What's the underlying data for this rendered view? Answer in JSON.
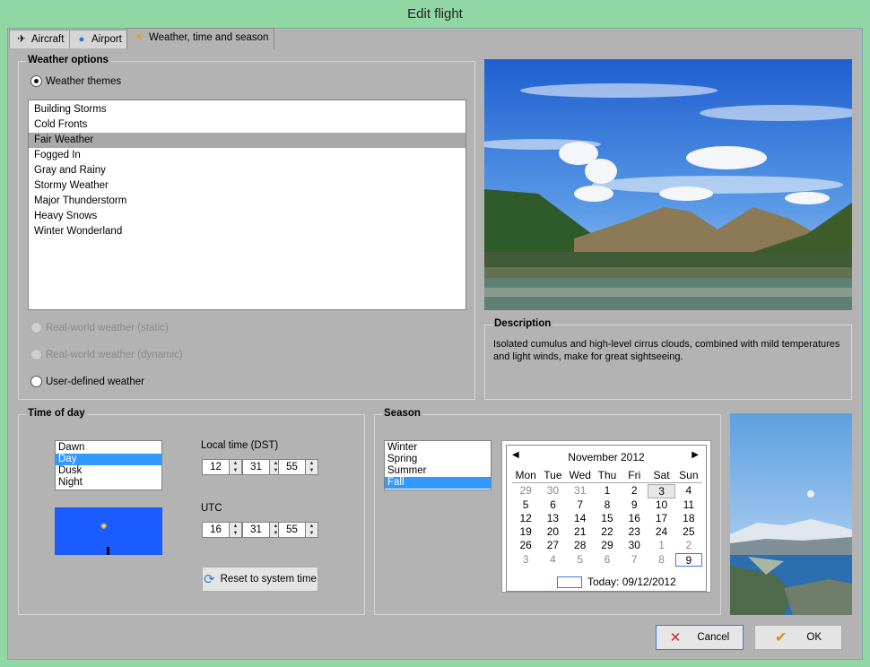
{
  "window": {
    "title": "Edit flight"
  },
  "tabs": [
    {
      "label": "Aircraft",
      "icon": "airplane-icon"
    },
    {
      "label": "Airport",
      "icon": "globe-icon"
    },
    {
      "label": "Weather, time and season",
      "icon": "weather-icon"
    }
  ],
  "weather": {
    "group_title": "Weather options",
    "themes_radio": "Weather themes",
    "themes": [
      "Building Storms",
      "Cold Fronts",
      "Fair Weather",
      "Fogged In",
      "Gray and Rainy",
      "Stormy Weather",
      "Major Thunderstorm",
      "Heavy Snows",
      "Winter Wonderland"
    ],
    "selected_theme": "Fair Weather",
    "realworld_static": "Real-world weather (static)",
    "realworld_dynamic": "Real-world weather (dynamic)",
    "user_defined": "User-defined weather"
  },
  "description": {
    "title": "Description",
    "text": "Isolated cumulus and high-level cirrus clouds, combined with mild temperatures and light winds, make for great sightseeing."
  },
  "time_of_day": {
    "group_title": "Time of day",
    "options": [
      "Dawn",
      "Day",
      "Dusk",
      "Night"
    ],
    "selected": "Day",
    "local_label": "Local time (DST)",
    "local": {
      "hour": "12",
      "minute": "31",
      "second": "55"
    },
    "utc_label": "UTC",
    "utc": {
      "hour": "16",
      "minute": "31",
      "second": "55"
    },
    "reset_button": "Reset to system time"
  },
  "season": {
    "group_title": "Season",
    "options": [
      "Winter",
      "Spring",
      "Summer",
      "Fall"
    ],
    "selected": "Fall"
  },
  "calendar": {
    "month_label": "November 2012",
    "weekdays": [
      "Mon",
      "Tue",
      "Wed",
      "Thu",
      "Fri",
      "Sat",
      "Sun"
    ],
    "weeks": [
      [
        "29",
        "30",
        "31",
        "1",
        "2",
        "3",
        "4"
      ],
      [
        "5",
        "6",
        "7",
        "8",
        "9",
        "10",
        "11"
      ],
      [
        "12",
        "13",
        "14",
        "15",
        "16",
        "17",
        "18"
      ],
      [
        "19",
        "20",
        "21",
        "22",
        "23",
        "24",
        "25"
      ],
      [
        "26",
        "27",
        "28",
        "29",
        "30",
        "1",
        "2"
      ],
      [
        "3",
        "4",
        "5",
        "6",
        "7",
        "8",
        "9"
      ]
    ],
    "today_label": "Today: 09/12/2012"
  },
  "buttons": {
    "cancel": "Cancel",
    "ok": "OK"
  },
  "colors": {
    "accent": "#3399ff",
    "time_preview": "#1a5cff",
    "window_frame": "#90d7a4"
  }
}
